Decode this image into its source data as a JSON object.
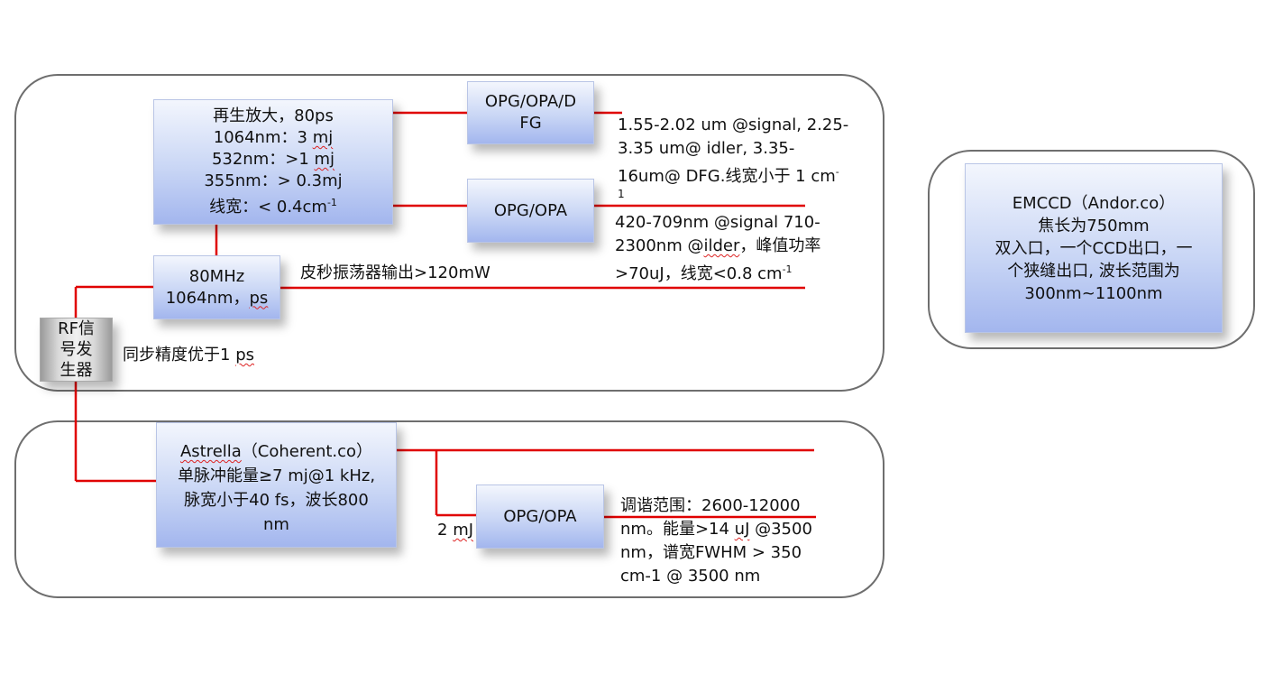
{
  "regen_amp": {
    "line1": "再生放大，80ps",
    "line2a": "1064nm：3 ",
    "line2b": "mj",
    "line3a": "532nm：>1 ",
    "line3b": "mj",
    "line4": "355nm：> 0.3mj",
    "line5a": "线宽：< 0.4cm",
    "line5sup": "-1"
  },
  "opg_dfg": {
    "line1": "OPG/OPA/D",
    "line2": "FG"
  },
  "dfg_desc": {
    "line1": "1.55-2.02 um @signal, 2.25-",
    "line2": "3.35 um@ idler, 3.35-",
    "line3a": "16um@ DFG.线宽小于 1 cm",
    "line3sup": "-",
    "line4": "1"
  },
  "opg_opa_top": {
    "label": "OPG/OPA"
  },
  "opa_desc": {
    "line1": "420-709nm @signal 710-",
    "line2a": "2300nm @",
    "line2b": "ilder",
    "line2c": "，峰值功率",
    "line3a": ">70uJ，线宽<0.8 cm",
    "line3sup": "-1"
  },
  "oscillator": {
    "line1": "80MHz",
    "line2a": "1064nm，",
    "line2b": "ps"
  },
  "osc_output": "皮秒振荡器输出>120mW",
  "rf_gen": {
    "line1": "RF信",
    "line2": "号发",
    "line3": "生器"
  },
  "sync_text": {
    "a": "同步精度优于1 ",
    "b": "ps"
  },
  "emccd": {
    "line1": "EMCCD（Andor.co）",
    "line2": "焦长为750mm",
    "line3": "双入口，一个CCD出口，一",
    "line4": "个狭缝出口, 波长范围为",
    "line5": "300nm~1100nm"
  },
  "astrella": {
    "line1a": "Astrella",
    "line1b": "（Coherent.co）",
    "line2": "单脉冲能量≥7 mj@1 kHz,",
    "line3": "脉宽小于40 fs，波长800",
    "line4": "nm"
  },
  "opg_opa_bottom": {
    "label": "OPG/OPA"
  },
  "mj_label": {
    "a": "2 ",
    "b": "mJ"
  },
  "tuning_desc": {
    "line1": "调谐范围：2600-12000",
    "line2a": "nm。能量>14 ",
    "line2b": "uJ",
    "line2c": " @3500",
    "line3": "nm，谱宽FWHM > 350",
    "line4": "cm-1 @ 3500 nm"
  },
  "colors": {
    "line": "#e00000",
    "border": "#6e6e6e",
    "box_top": "#f3f6fd",
    "box_bottom": "#a3b6ee"
  }
}
